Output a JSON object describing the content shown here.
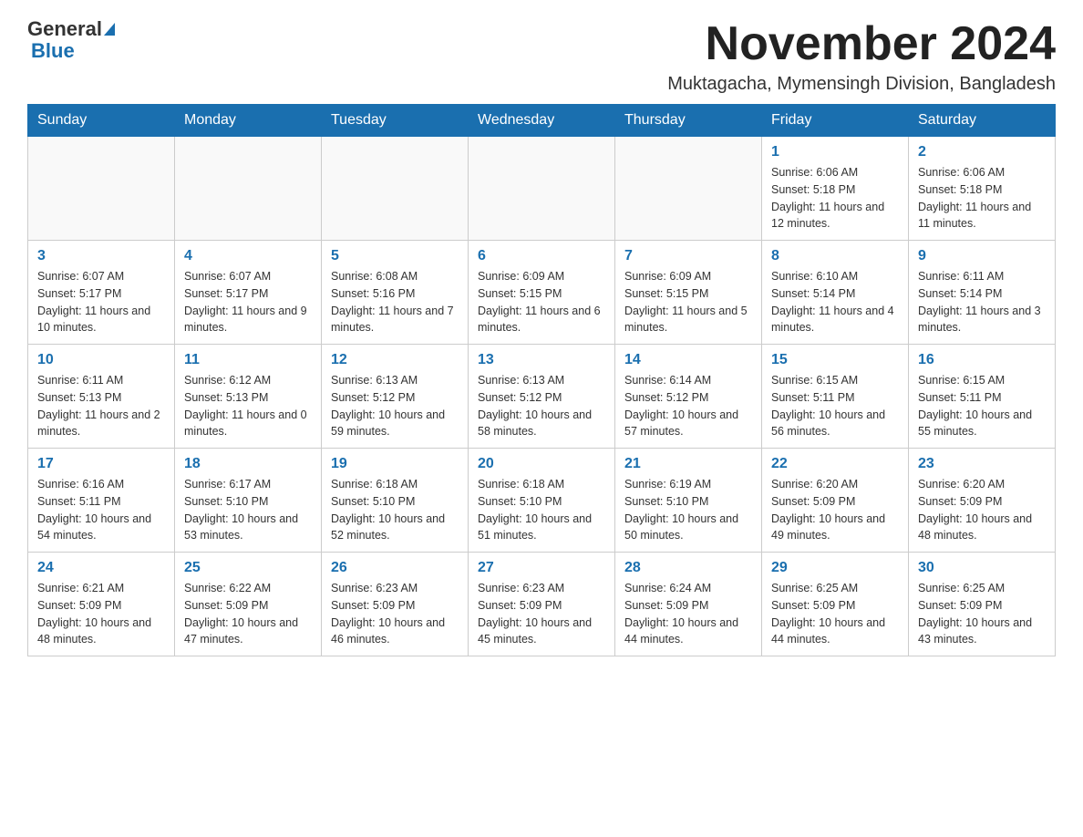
{
  "logo": {
    "text_general": "General",
    "text_blue": "Blue"
  },
  "title": "November 2024",
  "subtitle": "Muktagacha, Mymensingh Division, Bangladesh",
  "days_of_week": [
    "Sunday",
    "Monday",
    "Tuesday",
    "Wednesday",
    "Thursday",
    "Friday",
    "Saturday"
  ],
  "weeks": [
    [
      {
        "day": "",
        "info": ""
      },
      {
        "day": "",
        "info": ""
      },
      {
        "day": "",
        "info": ""
      },
      {
        "day": "",
        "info": ""
      },
      {
        "day": "",
        "info": ""
      },
      {
        "day": "1",
        "info": "Sunrise: 6:06 AM\nSunset: 5:18 PM\nDaylight: 11 hours and 12 minutes."
      },
      {
        "day": "2",
        "info": "Sunrise: 6:06 AM\nSunset: 5:18 PM\nDaylight: 11 hours and 11 minutes."
      }
    ],
    [
      {
        "day": "3",
        "info": "Sunrise: 6:07 AM\nSunset: 5:17 PM\nDaylight: 11 hours and 10 minutes."
      },
      {
        "day": "4",
        "info": "Sunrise: 6:07 AM\nSunset: 5:17 PM\nDaylight: 11 hours and 9 minutes."
      },
      {
        "day": "5",
        "info": "Sunrise: 6:08 AM\nSunset: 5:16 PM\nDaylight: 11 hours and 7 minutes."
      },
      {
        "day": "6",
        "info": "Sunrise: 6:09 AM\nSunset: 5:15 PM\nDaylight: 11 hours and 6 minutes."
      },
      {
        "day": "7",
        "info": "Sunrise: 6:09 AM\nSunset: 5:15 PM\nDaylight: 11 hours and 5 minutes."
      },
      {
        "day": "8",
        "info": "Sunrise: 6:10 AM\nSunset: 5:14 PM\nDaylight: 11 hours and 4 minutes."
      },
      {
        "day": "9",
        "info": "Sunrise: 6:11 AM\nSunset: 5:14 PM\nDaylight: 11 hours and 3 minutes."
      }
    ],
    [
      {
        "day": "10",
        "info": "Sunrise: 6:11 AM\nSunset: 5:13 PM\nDaylight: 11 hours and 2 minutes."
      },
      {
        "day": "11",
        "info": "Sunrise: 6:12 AM\nSunset: 5:13 PM\nDaylight: 11 hours and 0 minutes."
      },
      {
        "day": "12",
        "info": "Sunrise: 6:13 AM\nSunset: 5:12 PM\nDaylight: 10 hours and 59 minutes."
      },
      {
        "day": "13",
        "info": "Sunrise: 6:13 AM\nSunset: 5:12 PM\nDaylight: 10 hours and 58 minutes."
      },
      {
        "day": "14",
        "info": "Sunrise: 6:14 AM\nSunset: 5:12 PM\nDaylight: 10 hours and 57 minutes."
      },
      {
        "day": "15",
        "info": "Sunrise: 6:15 AM\nSunset: 5:11 PM\nDaylight: 10 hours and 56 minutes."
      },
      {
        "day": "16",
        "info": "Sunrise: 6:15 AM\nSunset: 5:11 PM\nDaylight: 10 hours and 55 minutes."
      }
    ],
    [
      {
        "day": "17",
        "info": "Sunrise: 6:16 AM\nSunset: 5:11 PM\nDaylight: 10 hours and 54 minutes."
      },
      {
        "day": "18",
        "info": "Sunrise: 6:17 AM\nSunset: 5:10 PM\nDaylight: 10 hours and 53 minutes."
      },
      {
        "day": "19",
        "info": "Sunrise: 6:18 AM\nSunset: 5:10 PM\nDaylight: 10 hours and 52 minutes."
      },
      {
        "day": "20",
        "info": "Sunrise: 6:18 AM\nSunset: 5:10 PM\nDaylight: 10 hours and 51 minutes."
      },
      {
        "day": "21",
        "info": "Sunrise: 6:19 AM\nSunset: 5:10 PM\nDaylight: 10 hours and 50 minutes."
      },
      {
        "day": "22",
        "info": "Sunrise: 6:20 AM\nSunset: 5:09 PM\nDaylight: 10 hours and 49 minutes."
      },
      {
        "day": "23",
        "info": "Sunrise: 6:20 AM\nSunset: 5:09 PM\nDaylight: 10 hours and 48 minutes."
      }
    ],
    [
      {
        "day": "24",
        "info": "Sunrise: 6:21 AM\nSunset: 5:09 PM\nDaylight: 10 hours and 48 minutes."
      },
      {
        "day": "25",
        "info": "Sunrise: 6:22 AM\nSunset: 5:09 PM\nDaylight: 10 hours and 47 minutes."
      },
      {
        "day": "26",
        "info": "Sunrise: 6:23 AM\nSunset: 5:09 PM\nDaylight: 10 hours and 46 minutes."
      },
      {
        "day": "27",
        "info": "Sunrise: 6:23 AM\nSunset: 5:09 PM\nDaylight: 10 hours and 45 minutes."
      },
      {
        "day": "28",
        "info": "Sunrise: 6:24 AM\nSunset: 5:09 PM\nDaylight: 10 hours and 44 minutes."
      },
      {
        "day": "29",
        "info": "Sunrise: 6:25 AM\nSunset: 5:09 PM\nDaylight: 10 hours and 44 minutes."
      },
      {
        "day": "30",
        "info": "Sunrise: 6:25 AM\nSunset: 5:09 PM\nDaylight: 10 hours and 43 minutes."
      }
    ]
  ]
}
